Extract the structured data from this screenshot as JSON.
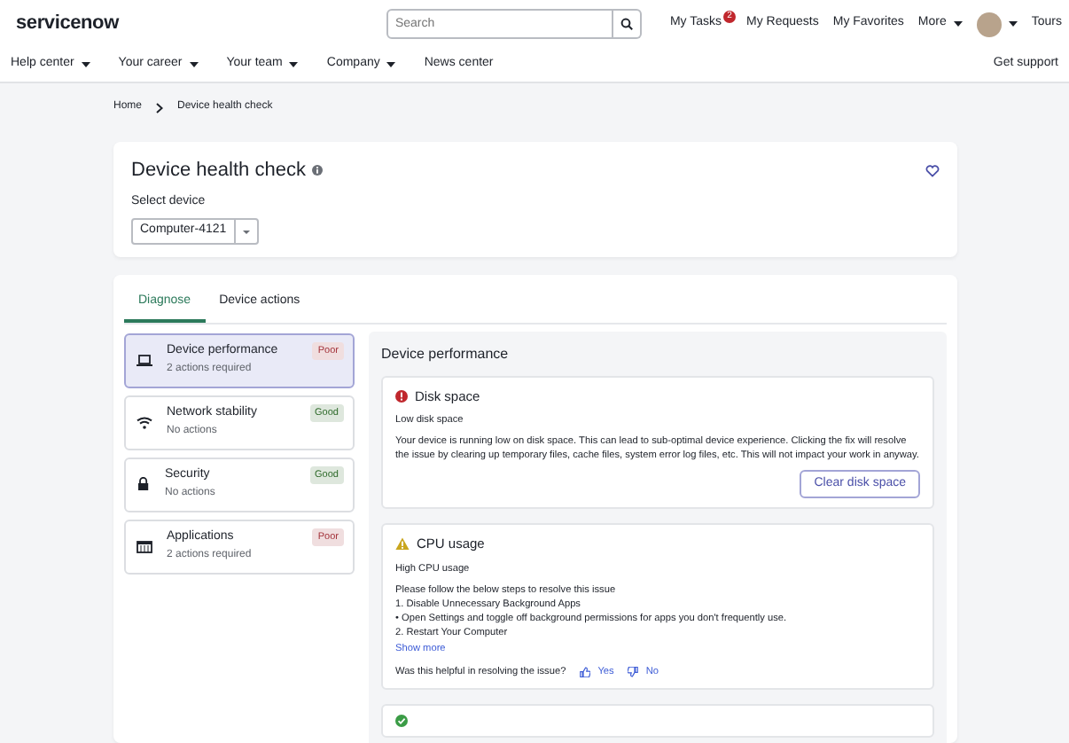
{
  "header": {
    "logo": "servicenow",
    "search": {
      "placeholder": "Search"
    },
    "links": [
      {
        "label": "My Tasks",
        "badge": "2"
      },
      {
        "label": "My Requests"
      },
      {
        "label": "My Favorites"
      },
      {
        "label": "More",
        "dropdown": true
      }
    ],
    "tours": "Tours"
  },
  "nav": {
    "items": [
      {
        "label": "Help center",
        "dropdown": true
      },
      {
        "label": "Your career",
        "dropdown": true
      },
      {
        "label": "Your team",
        "dropdown": true
      },
      {
        "label": "Company",
        "dropdown": true
      },
      {
        "label": "News center",
        "dropdown": false
      }
    ],
    "support": "Get support"
  },
  "breadcrumb": [
    "Home",
    "Device health check"
  ],
  "title": "Device health check",
  "select_label": "Select device",
  "device": "Computer-4121",
  "tabs": [
    {
      "label": "Diagnose",
      "selected": true
    },
    {
      "label": "Device actions",
      "selected": false
    }
  ],
  "categories": [
    {
      "kind": "laptop",
      "name": "Device performance",
      "sub": "2 actions required",
      "status": "Poor",
      "color": "#a3323a",
      "selected": true
    },
    {
      "kind": "wifi",
      "name": "Network stability",
      "sub": "No actions",
      "status": "Good",
      "color": "#2f6b2b",
      "selected": false
    },
    {
      "kind": "lock",
      "name": "Security",
      "sub": "No actions",
      "status": "Good",
      "color": "#2f6b2b",
      "selected": false
    },
    {
      "kind": "apps",
      "name": "Applications",
      "sub": "2 actions required",
      "status": "Poor",
      "color": "#a3323a",
      "selected": false
    }
  ],
  "panel": {
    "heading": "Device performance",
    "issues": [
      {
        "kind": "error",
        "title": "Disk space",
        "subtitle": "Low disk space",
        "body": [
          "Your device is running low on disk space. This can lead to sub-optimal device experience. Clicking the fix will resolve the issue by clearing up temporary files, cache files, system error log files, etc. This will not impact your work in anyway."
        ],
        "action": "Clear disk space"
      },
      {
        "kind": "warning",
        "title": "CPU usage",
        "subtitle": "High CPU usage",
        "body": [
          "Please follow the below steps to resolve this issue",
          "1. Disable Unnecessary Background Apps",
          "• Open Settings and toggle off background permissions for apps you don't frequently use.",
          "2. Restart Your Computer"
        ],
        "more": "Show more",
        "feedback": {
          "question": "Was this helpful in resolving the issue?",
          "yes": "Yes",
          "no": "No"
        }
      },
      {
        "kind": "ok"
      }
    ]
  }
}
